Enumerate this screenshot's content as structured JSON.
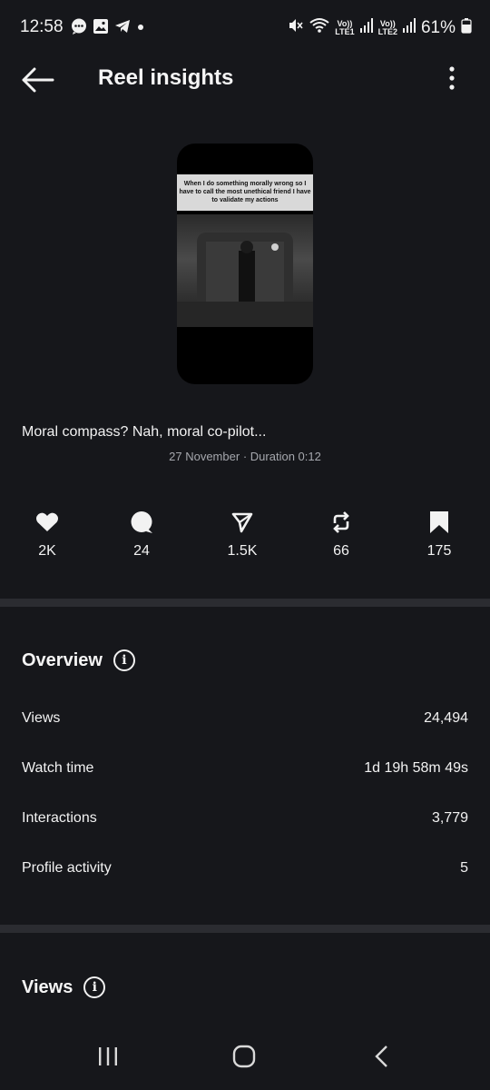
{
  "status_bar": {
    "time": "12:58",
    "sim1_label_top": "Vo))",
    "sim1_label_bottom": "LTE1",
    "sim2_label_top": "Vo))",
    "sim2_label_bottom": "LTE2",
    "battery": "61%"
  },
  "header": {
    "title": "Reel insights"
  },
  "reel": {
    "thumbnail_caption": "When I do something morally wrong so I have to call the most unethical friend I have to validate my actions",
    "caption": "Moral compass? Nah, moral co-pilot...",
    "date": "27 November",
    "separator": "·",
    "duration": "Duration 0:12"
  },
  "stats": {
    "likes": "2K",
    "comments": "24",
    "shares": "1.5K",
    "reposts": "66",
    "saves": "175"
  },
  "overview": {
    "title": "Overview",
    "rows": [
      {
        "label": "Views",
        "value": "24,494"
      },
      {
        "label": "Watch time",
        "value": "1d 19h 58m 49s"
      },
      {
        "label": "Interactions",
        "value": "3,779"
      },
      {
        "label": "Profile activity",
        "value": "5"
      }
    ]
  },
  "views_section": {
    "title": "Views"
  },
  "colors": {
    "background": "#16171b",
    "divider": "#2b2c31",
    "muted_text": "#a5a7ad"
  }
}
